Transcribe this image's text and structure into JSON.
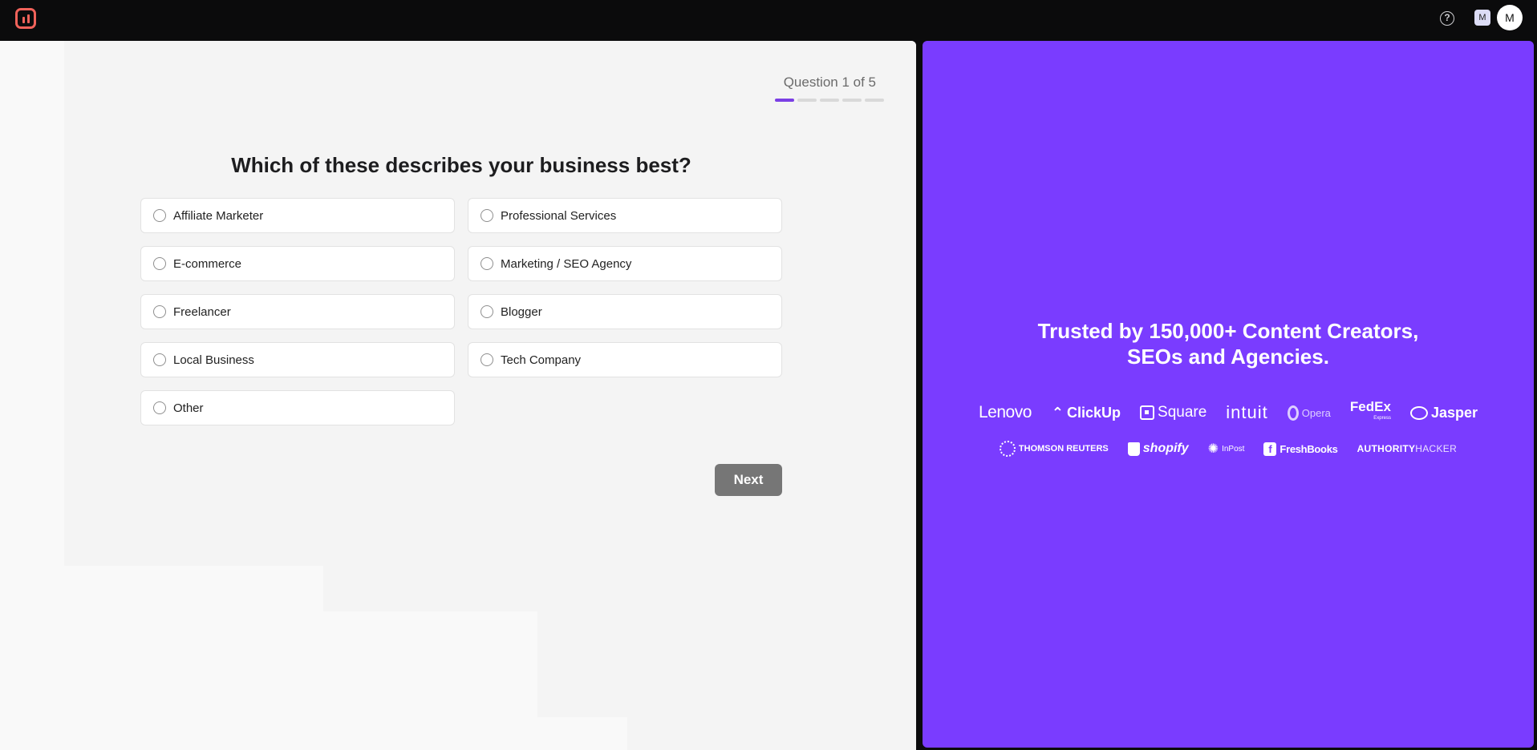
{
  "header": {
    "help_icon": "question-circle-icon",
    "help_glyph": "?",
    "workspace_initial": "M",
    "avatar_initial": "M"
  },
  "quiz": {
    "counter": "Question 1 of 5",
    "progress_current": 1,
    "progress_total": 5,
    "question": "Which of these describes your business best?",
    "options": [
      "Affiliate Marketer",
      "Professional Services",
      "E-commerce",
      "Marketing / SEO Agency",
      "Freelancer",
      "Blogger",
      "Local Business",
      "Tech Company",
      "Other"
    ],
    "next_label": "Next"
  },
  "promo": {
    "headline_line1": "Trusted by 150,000+ Content Creators,",
    "headline_line2": "SEOs and Agencies.",
    "logos_row1": [
      "Lenovo",
      "ClickUp",
      "Square",
      "intuit",
      "Opera",
      "FedEx",
      "Jasper"
    ],
    "logos_row2": [
      "THOMSON REUTERS",
      "shopify",
      "InPost",
      "FreshBooks",
      "AUTHORITY",
      "HACKER"
    ],
    "fedex_sub": "Express",
    "accent_color": "#7a3cff"
  }
}
